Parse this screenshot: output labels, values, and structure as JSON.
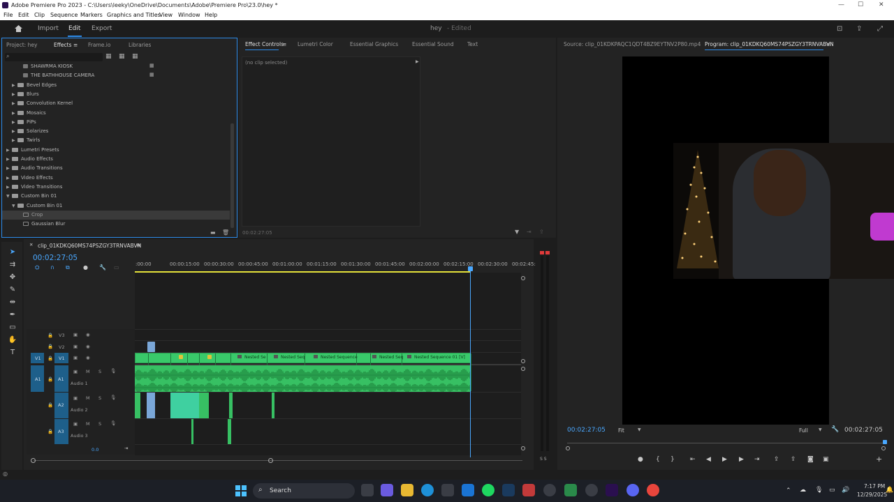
{
  "window": {
    "title": "Adobe Premiere Pro 2023 - C:\\Users\\leeky\\OneDrive\\Documents\\Adobe\\Premiere Pro\\23.0\\hey *"
  },
  "menu": [
    "File",
    "Edit",
    "Clip",
    "Sequence",
    "Markers",
    "Graphics and Titles",
    "View",
    "Window",
    "Help"
  ],
  "workspace": {
    "tabs": [
      "Import",
      "Edit",
      "Export"
    ],
    "active": "Edit",
    "project_name": "hey",
    "status": "- Edited"
  },
  "left_panel": {
    "tabs": [
      "Project: hey",
      "Effects",
      "Frame.io",
      "Libraries"
    ],
    "active_tab": "Effects",
    "tree": [
      {
        "label": "SHAWRMA KIOSK",
        "indent": 2,
        "type": "preset"
      },
      {
        "label": "THE BATHHOUSE CAMERA",
        "indent": 2,
        "type": "preset"
      },
      {
        "label": "Bevel Edges",
        "indent": 1,
        "type": "folder"
      },
      {
        "label": "Blurs",
        "indent": 1,
        "type": "folder"
      },
      {
        "label": "Convolution Kernel",
        "indent": 1,
        "type": "folder"
      },
      {
        "label": "Mosaics",
        "indent": 1,
        "type": "folder"
      },
      {
        "label": "PiPs",
        "indent": 1,
        "type": "folder"
      },
      {
        "label": "Solarizes",
        "indent": 1,
        "type": "folder"
      },
      {
        "label": "Twirls",
        "indent": 1,
        "type": "folder"
      },
      {
        "label": "Lumetri Presets",
        "indent": 0,
        "type": "folder"
      },
      {
        "label": "Audio Effects",
        "indent": 0,
        "type": "folder"
      },
      {
        "label": "Audio Transitions",
        "indent": 0,
        "type": "folder"
      },
      {
        "label": "Video Effects",
        "indent": 0,
        "type": "folder"
      },
      {
        "label": "Video Transitions",
        "indent": 0,
        "type": "folder"
      },
      {
        "label": "Custom Bin 01",
        "indent": 0,
        "type": "folder-open"
      },
      {
        "label": "Custom Bin 01",
        "indent": 1,
        "type": "folder-open"
      },
      {
        "label": "Crop",
        "indent": 2,
        "type": "effect",
        "selected": true
      },
      {
        "label": "Gaussian Blur",
        "indent": 2,
        "type": "effect"
      }
    ]
  },
  "effect_controls": {
    "tabs": [
      "Effect Controls",
      "Lumetri Color",
      "Essential Graphics",
      "Essential Sound",
      "Text"
    ],
    "active_tab": "Effect Controls",
    "no_clip": "(no clip selected)",
    "timecode": "00:02:27:05"
  },
  "monitor": {
    "source_tab": "Source: clip_01KDKPAQC1QDT4BZ9EYTNV2P80.mp4",
    "program_tab": "Program: clip_01KDKQ60MS74PSZGY3TRNVABVN",
    "timecode": "00:02:27:05",
    "duration": "00:02:27:05",
    "fit": "Fit",
    "quality": "Full"
  },
  "timeline": {
    "sequence_name": "clip_01KDKQ60MS74PSZGY3TRNVABVN",
    "timecode": "00:02:27:05",
    "ruler": [
      ":00:00",
      "00:00:15:00",
      "00:00:30:00",
      "00:00:45:00",
      "00:01:00:00",
      "00:01:15:00",
      "00:01:30:00",
      "00:01:45:00",
      "00:02:00:00",
      "00:02:15:00",
      "00:02:30:00",
      "00:02:45:"
    ],
    "video_tracks": [
      "V3",
      "V2",
      "V1"
    ],
    "audio_tracks": [
      {
        "id": "A1",
        "name": "Audio 1"
      },
      {
        "id": "A2",
        "name": "Audio 2"
      },
      {
        "id": "A3",
        "name": "Audio 3"
      }
    ],
    "source_v": "V1",
    "source_a": "A1",
    "mix_value": "0.0",
    "clip_labels": [
      "Nested Se",
      "Nested Seq",
      "Nested Sequence",
      "Nested Seq",
      "Nested Sequence 01 [V]"
    ],
    "meter_label": "S S"
  },
  "taskbar": {
    "search": "Search",
    "time": "7:17 PM",
    "date": "12/29/2025"
  },
  "colors": {
    "accent": "#2d8ceb",
    "clip_green": "#39c96a",
    "clip_teal": "#3fd0a0",
    "playhead": "#4aa8ff",
    "track_target": "#1e5f8a"
  }
}
